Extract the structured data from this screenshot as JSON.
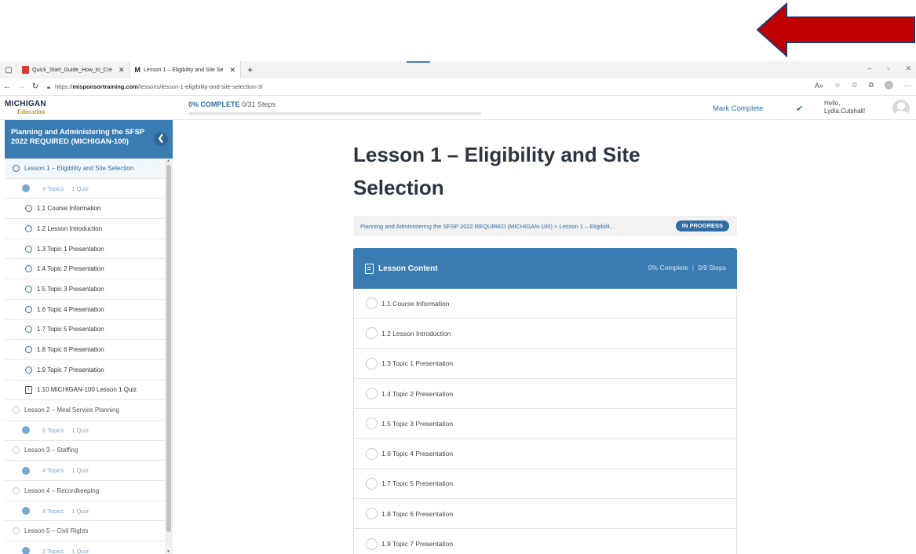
{
  "browser": {
    "tabs": [
      {
        "title": "Quick_Start_Guide_How_to_Cre",
        "icon": "pdf-icon"
      },
      {
        "title": "Lesson 1 – Eligibility and Site Se",
        "icon": "m-icon"
      }
    ],
    "tab_close": "✕",
    "new_tab": "+",
    "url_prefix": "https://",
    "url_host": "misponsortraining.com",
    "url_path": "/lessons/lesson-1-eligibility-and-site-selection-3/"
  },
  "header": {
    "logo_top": "MICHIGAN",
    "logo_bottom": "Education",
    "progress_percent": "0% COMPLETE",
    "progress_steps": "0/31 Steps",
    "progress_fraction": 0,
    "mark_complete": "Mark Complete",
    "greeting_line1": "Hello,",
    "greeting_line2": "Lydia.Cutshall!"
  },
  "sidebar": {
    "course_title": "Planning and Administering the SFSP 2022 REQUIRED (MICHIGAN-100)",
    "rows": [
      {
        "kind": "lesson-current",
        "label": "Lesson 1 – Eligibility and Site Selection"
      },
      {
        "kind": "meta",
        "topics": "9 Topics",
        "quiz": "1 Quiz"
      },
      {
        "kind": "topic",
        "label": "1.1 Course Information"
      },
      {
        "kind": "topic",
        "label": "1.2 Lesson Introduction"
      },
      {
        "kind": "topic",
        "label": "1.3 Topic 1 Presentation"
      },
      {
        "kind": "topic",
        "label": "1.4 Topic 2 Presentation"
      },
      {
        "kind": "topic",
        "label": "1.5 Topic 3 Presentation"
      },
      {
        "kind": "topic",
        "label": "1.6 Topic 4 Presentation"
      },
      {
        "kind": "topic",
        "label": "1.7 Topic 5 Presentation"
      },
      {
        "kind": "topic",
        "label": "1.8 Topic 6 Presentation"
      },
      {
        "kind": "topic",
        "label": "1.9 Topic 7 Presentation"
      },
      {
        "kind": "quiz",
        "label": "1.10 MICHIGAN-100 Lesson 1 Quiz"
      },
      {
        "kind": "lesson",
        "label": "Lesson 2 – Meal Service Planning"
      },
      {
        "kind": "meta",
        "topics": "6 Topics",
        "quiz": "1 Quiz"
      },
      {
        "kind": "lesson",
        "label": "Lesson 3 – Staffing"
      },
      {
        "kind": "meta",
        "topics": "4 Topics",
        "quiz": "1 Quiz"
      },
      {
        "kind": "lesson",
        "label": "Lesson 4 – Recordkeeping"
      },
      {
        "kind": "meta",
        "topics": "4 Topics",
        "quiz": "1 Quiz"
      },
      {
        "kind": "lesson",
        "label": "Lesson 5 – Civil Rights"
      },
      {
        "kind": "meta",
        "topics": "2 Topics",
        "quiz": "1 Quiz"
      }
    ]
  },
  "main": {
    "lesson_title": "Lesson 1 – Eligibility and Site Selection",
    "breadcrumb": "Planning and Administering the SFSP 2022 REQUIRED (MICHIGAN-100) > Lesson 1 – Eligibilit...",
    "status": "IN PROGRESS",
    "content_title": "Lesson Content",
    "content_complete": "0% Complete",
    "content_steps": "0/9 Steps",
    "topics": [
      "1.1 Course Information",
      "1.2 Lesson Introduction",
      "1.3 Topic 1 Presentation",
      "1.4 Topic 2 Presentation",
      "1.5 Topic 3 Presentation",
      "1.6 Topic 4 Presentation",
      "1.7 Topic 5 Presentation",
      "1.8 Topic 6 Presentation",
      "1.9 Topic 7 Presentation"
    ]
  },
  "colors": {
    "accent": "#3a7bb1",
    "link": "#2f6da2",
    "annotation_arrow": "#c00000"
  }
}
